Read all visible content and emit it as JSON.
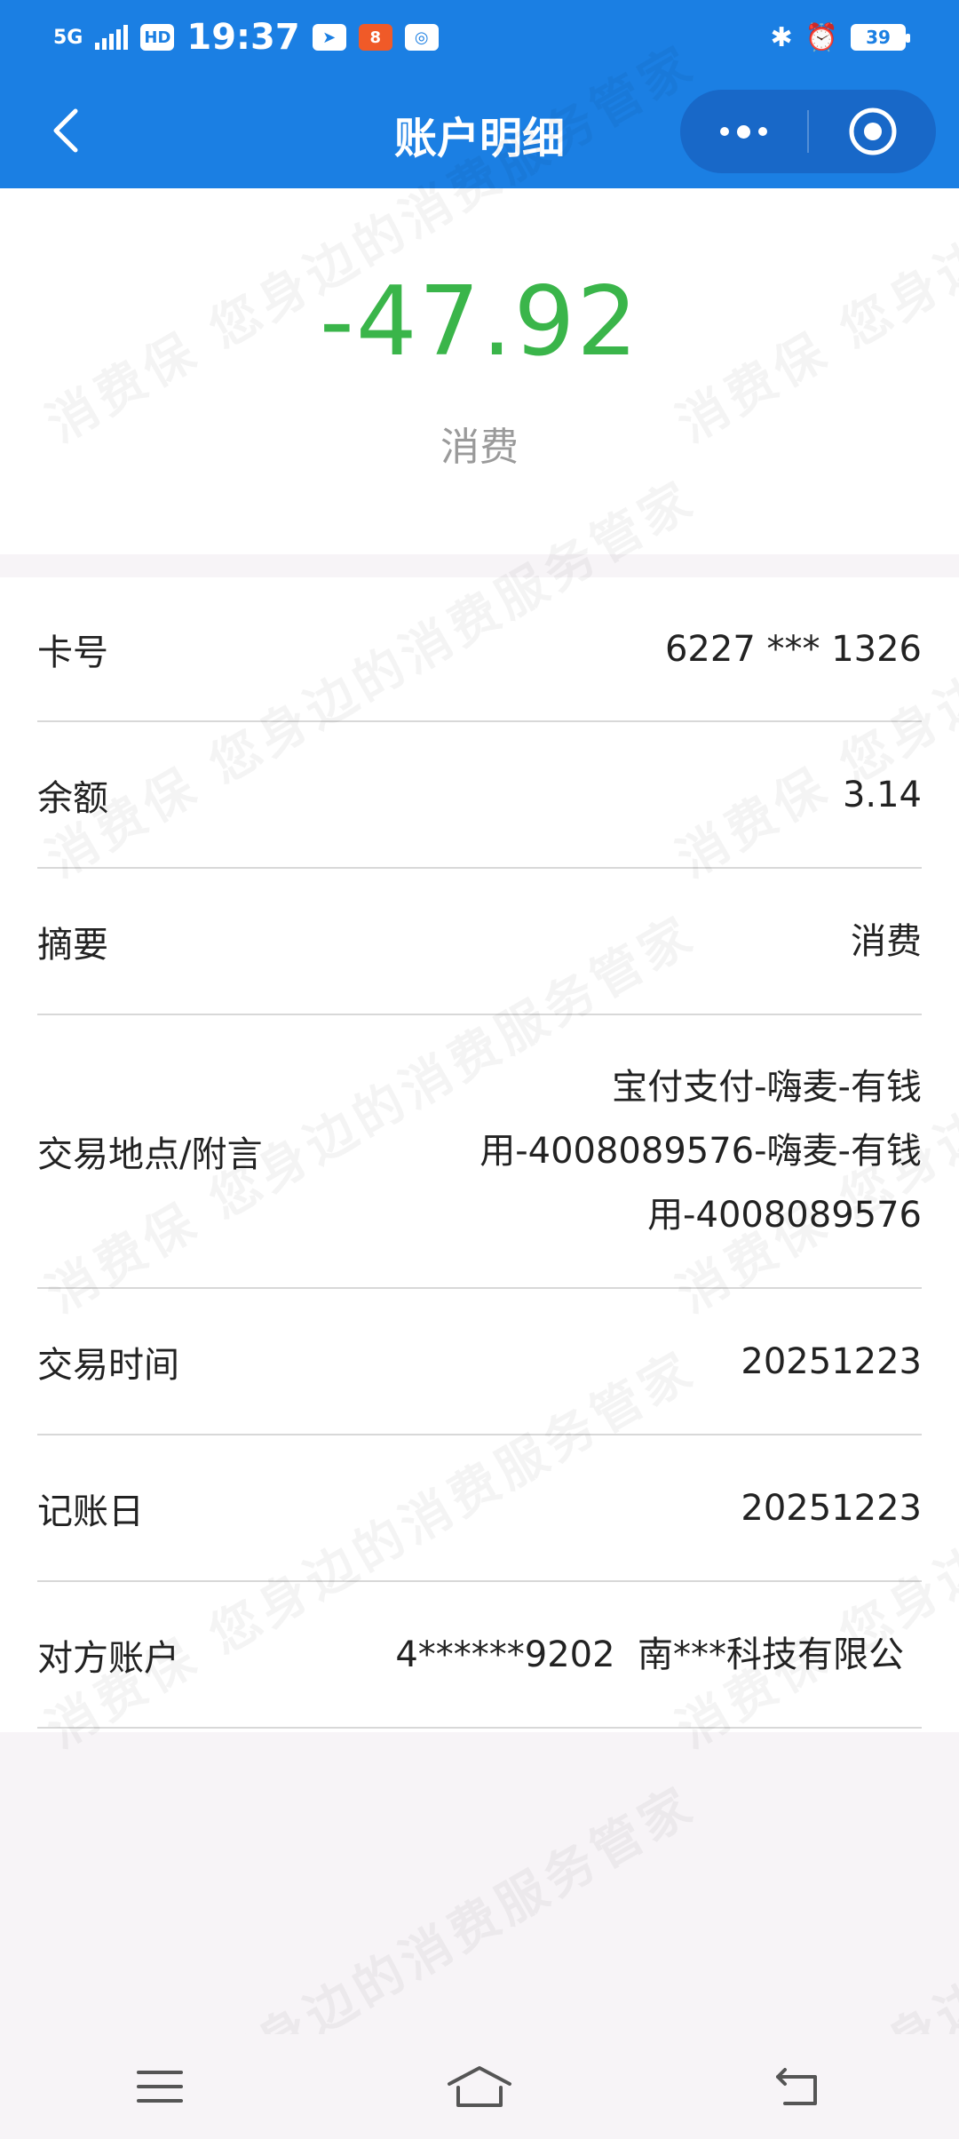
{
  "status": {
    "network": "5G",
    "hd": "HD",
    "time": "19:37",
    "battery": "39"
  },
  "header": {
    "title": "账户明细"
  },
  "transaction": {
    "amount": "-47.92",
    "type_label": "消费"
  },
  "details": [
    {
      "label": "卡号",
      "value": "6227 *** 1326"
    },
    {
      "label": "余额",
      "value": "3.14"
    },
    {
      "label": "摘要",
      "value": "消费"
    },
    {
      "label": "交易地点/附言",
      "value": "宝付支付-嗨麦-有钱用-4008089576-嗨麦-有钱用-4008089576"
    },
    {
      "label": "交易时间",
      "value": "20251223"
    },
    {
      "label": "记账日",
      "value": "20251223"
    },
    {
      "label": "对方账户",
      "value": "4******9202  南***科技有限公"
    }
  ],
  "watermark": {
    "text": "消费保 您身边的消费服务管家"
  },
  "colors": {
    "header_bg": "#1b7fe3",
    "amount": "#3ab54a"
  }
}
